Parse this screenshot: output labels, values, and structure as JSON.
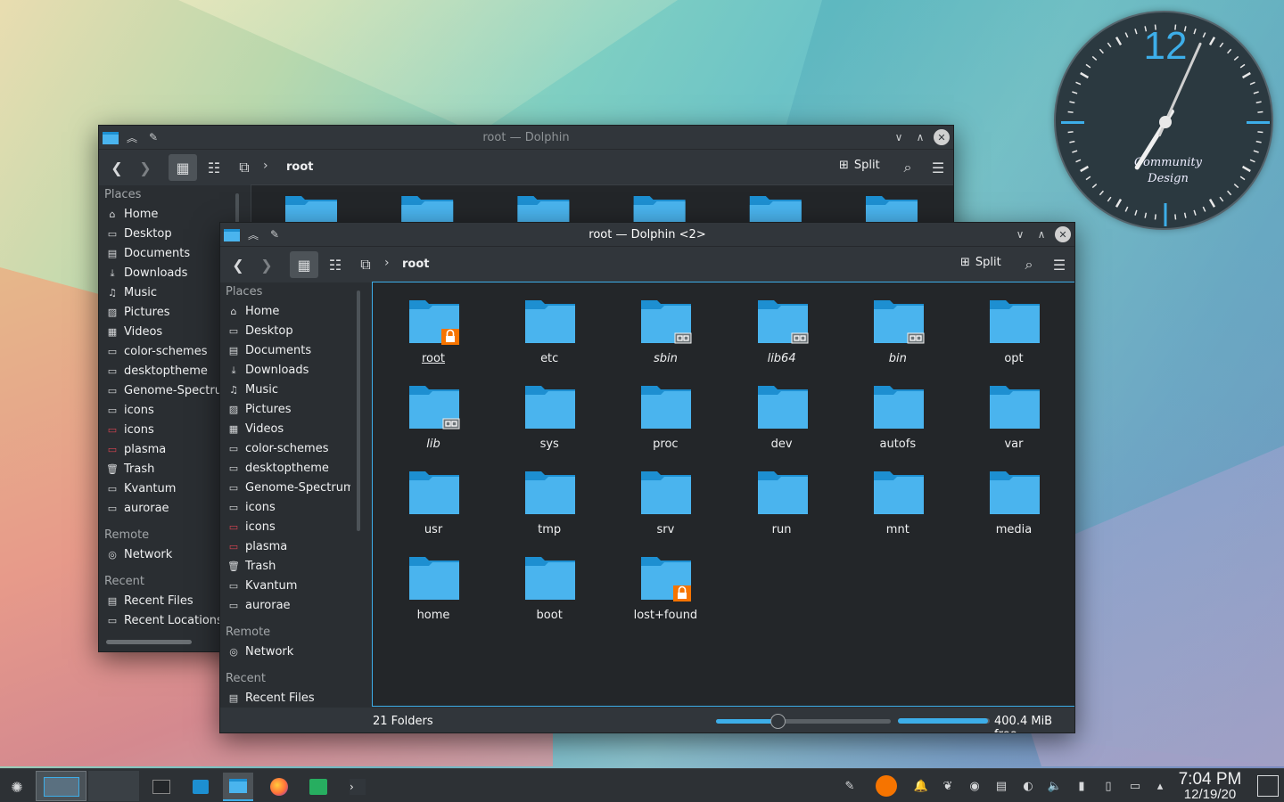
{
  "back_window": {
    "title": "root — Dolphin",
    "breadcrumb": "root",
    "split_label": "Split",
    "places": [
      {
        "type": "section",
        "label": "Places"
      },
      {
        "type": "item",
        "icon": "home-icon",
        "glyph": "⌂",
        "label": "Home"
      },
      {
        "type": "item",
        "icon": "desktop-icon",
        "glyph": "▭",
        "label": "Desktop"
      },
      {
        "type": "item",
        "icon": "documents-icon",
        "glyph": "▤",
        "label": "Documents"
      },
      {
        "type": "item",
        "icon": "downloads-icon",
        "glyph": "⤓",
        "label": "Downloads"
      },
      {
        "type": "item",
        "icon": "music-icon",
        "glyph": "♫",
        "label": "Music"
      },
      {
        "type": "item",
        "icon": "pictures-icon",
        "glyph": "▨",
        "label": "Pictures"
      },
      {
        "type": "item",
        "icon": "videos-icon",
        "glyph": "▦",
        "label": "Videos"
      },
      {
        "type": "item",
        "icon": "folder-icon",
        "glyph": "▭",
        "label": "color-schemes"
      },
      {
        "type": "item",
        "icon": "folder-icon",
        "glyph": "▭",
        "label": "desktoptheme"
      },
      {
        "type": "item",
        "icon": "folder-icon",
        "glyph": "▭",
        "label": "Genome-Spectrum"
      },
      {
        "type": "item",
        "icon": "folder-icon",
        "glyph": "▭",
        "label": "icons"
      },
      {
        "type": "item",
        "icon": "folder-red-icon",
        "glyph": "▭",
        "label": "icons",
        "red": true
      },
      {
        "type": "item",
        "icon": "folder-red-icon",
        "glyph": "▭",
        "label": "plasma",
        "red": true
      },
      {
        "type": "item",
        "icon": "trash-icon",
        "glyph": "🗑",
        "label": "Trash"
      },
      {
        "type": "item",
        "icon": "folder-icon",
        "glyph": "▭",
        "label": "Kvantum"
      },
      {
        "type": "item",
        "icon": "folder-icon",
        "glyph": "▭",
        "label": "aurorae"
      },
      {
        "type": "gap"
      },
      {
        "type": "section",
        "label": "Remote"
      },
      {
        "type": "item",
        "icon": "network-icon",
        "glyph": "◎",
        "label": "Network"
      },
      {
        "type": "gap"
      },
      {
        "type": "section",
        "label": "Recent"
      },
      {
        "type": "item",
        "icon": "recent-files-icon",
        "glyph": "▤",
        "label": "Recent Files"
      },
      {
        "type": "item",
        "icon": "recent-locations-icon",
        "glyph": "▭",
        "label": "Recent Locations"
      }
    ]
  },
  "front_window": {
    "title": "root — Dolphin <2>",
    "breadcrumb": "root",
    "split_label": "Split",
    "places": [
      {
        "type": "section",
        "label": "Places"
      },
      {
        "type": "item",
        "icon": "home-icon",
        "glyph": "⌂",
        "label": "Home"
      },
      {
        "type": "item",
        "icon": "desktop-icon",
        "glyph": "▭",
        "label": "Desktop"
      },
      {
        "type": "item",
        "icon": "documents-icon",
        "glyph": "▤",
        "label": "Documents"
      },
      {
        "type": "item",
        "icon": "downloads-icon",
        "glyph": "⤓",
        "label": "Downloads"
      },
      {
        "type": "item",
        "icon": "music-icon",
        "glyph": "♫",
        "label": "Music"
      },
      {
        "type": "item",
        "icon": "pictures-icon",
        "glyph": "▨",
        "label": "Pictures"
      },
      {
        "type": "item",
        "icon": "videos-icon",
        "glyph": "▦",
        "label": "Videos"
      },
      {
        "type": "item",
        "icon": "folder-icon",
        "glyph": "▭",
        "label": "color-schemes"
      },
      {
        "type": "item",
        "icon": "folder-icon",
        "glyph": "▭",
        "label": "desktoptheme"
      },
      {
        "type": "item",
        "icon": "folder-icon",
        "glyph": "▭",
        "label": "Genome-Spectrum"
      },
      {
        "type": "item",
        "icon": "folder-icon",
        "glyph": "▭",
        "label": "icons"
      },
      {
        "type": "item",
        "icon": "folder-red-icon",
        "glyph": "▭",
        "label": "icons",
        "red": true
      },
      {
        "type": "item",
        "icon": "folder-red-icon",
        "glyph": "▭",
        "label": "plasma",
        "red": true
      },
      {
        "type": "item",
        "icon": "trash-icon",
        "glyph": "🗑",
        "label": "Trash"
      },
      {
        "type": "item",
        "icon": "folder-icon",
        "glyph": "▭",
        "label": "Kvantum"
      },
      {
        "type": "item",
        "icon": "folder-icon",
        "glyph": "▭",
        "label": "aurorae"
      },
      {
        "type": "gap"
      },
      {
        "type": "section",
        "label": "Remote"
      },
      {
        "type": "item",
        "icon": "network-icon",
        "glyph": "◎",
        "label": "Network"
      },
      {
        "type": "gap"
      },
      {
        "type": "section",
        "label": "Recent"
      },
      {
        "type": "item",
        "icon": "recent-files-icon",
        "glyph": "▤",
        "label": "Recent Files"
      }
    ],
    "folders": [
      {
        "name": "root",
        "emblem": "lock",
        "selected": true
      },
      {
        "name": "etc"
      },
      {
        "name": "sbin",
        "emblem": "link",
        "italic": true
      },
      {
        "name": "lib64",
        "emblem": "link",
        "italic": true
      },
      {
        "name": "bin",
        "emblem": "link",
        "italic": true
      },
      {
        "name": "opt"
      },
      {
        "name": "lib",
        "emblem": "link",
        "italic": true
      },
      {
        "name": "sys"
      },
      {
        "name": "proc"
      },
      {
        "name": "dev"
      },
      {
        "name": "autofs"
      },
      {
        "name": "var"
      },
      {
        "name": "usr"
      },
      {
        "name": "tmp"
      },
      {
        "name": "srv"
      },
      {
        "name": "run"
      },
      {
        "name": "mnt"
      },
      {
        "name": "media"
      },
      {
        "name": "home"
      },
      {
        "name": "boot"
      },
      {
        "name": "lost+found",
        "emblem": "lock"
      }
    ],
    "status_text": "21 Folders",
    "zoom_level": 0.35,
    "free_space_text": "400.4 MiB free",
    "free_space_used_fraction": 0.98
  },
  "clock": {
    "numeral_12": "12",
    "brand_line1": "Community",
    "brand_line2": "Design",
    "hour": 7,
    "minute": 4
  },
  "taskbar": {
    "time": "7:04 PM",
    "date": "12/19/20"
  },
  "colors": {
    "accent": "#3daee9",
    "folder_light": "#4ab4ee",
    "folder_dark": "#1d8fd1",
    "emblem_lock": "#f67400",
    "red_folder": "#da4453"
  }
}
